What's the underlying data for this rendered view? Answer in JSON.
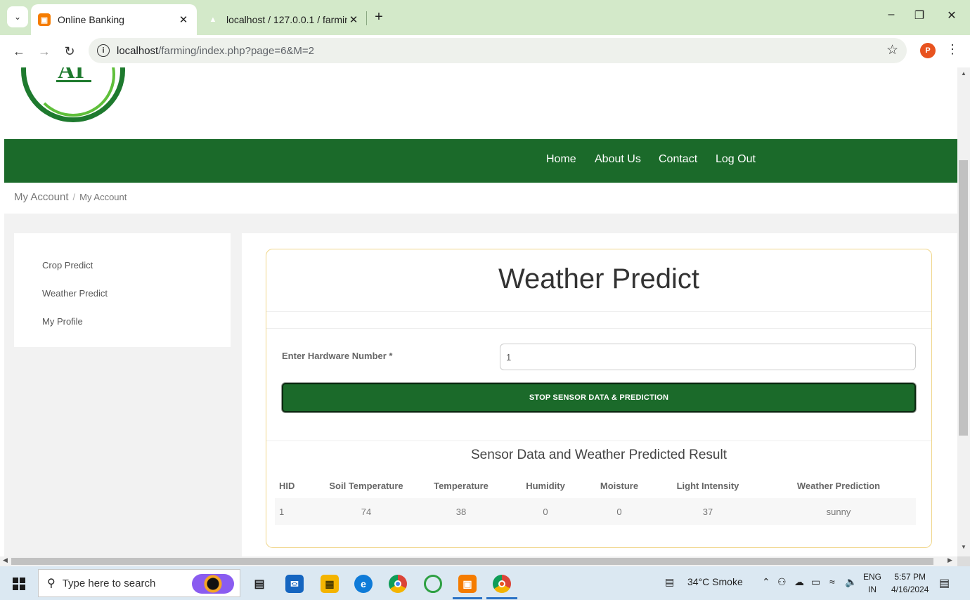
{
  "browser": {
    "tabs": [
      {
        "title": "Online Banking",
        "favicon": "xampp-icon",
        "active": true
      },
      {
        "title": "localhost / 127.0.0.1 / farming /",
        "favicon": "phpmyadmin-icon",
        "active": false
      }
    ],
    "url_host": "localhost",
    "url_path": "/farming/index.php?page=6&M=2",
    "profile_initial": "P"
  },
  "logo": {
    "text": "AI"
  },
  "site_nav": {
    "items": [
      "Home",
      "About Us",
      "Contact",
      "Log Out"
    ]
  },
  "breadcrumb": {
    "root": "My Account",
    "separator": "/",
    "current": "My Account"
  },
  "sidebar": {
    "items": [
      "Crop Predict",
      "Weather Predict",
      "My Profile"
    ]
  },
  "form": {
    "title": "Weather Predict",
    "hardware_label": "Enter Hardware Number *",
    "hardware_value": "1",
    "button_label": "STOP SENSOR DATA & PREDICTION"
  },
  "results": {
    "title": "Sensor Data and Weather Predicted Result",
    "headers": [
      "HID",
      "Soil Temperature",
      "Temperature",
      "Humidity",
      "Moisture",
      "Light Intensity",
      "Weather Prediction"
    ],
    "rows": [
      [
        "1",
        "74",
        "38",
        "0",
        "0",
        "37",
        "sunny"
      ]
    ]
  },
  "taskbar": {
    "search_placeholder": "Type here to search",
    "weather": "34°C  Smoke",
    "lang_top": "ENG",
    "lang_bottom": "IN",
    "time": "5:57 PM",
    "date": "4/16/2024"
  },
  "colors": {
    "brand_green": "#1b6a2a",
    "card_border": "#f0d68a",
    "tabstrip": "#d3e9c9"
  }
}
